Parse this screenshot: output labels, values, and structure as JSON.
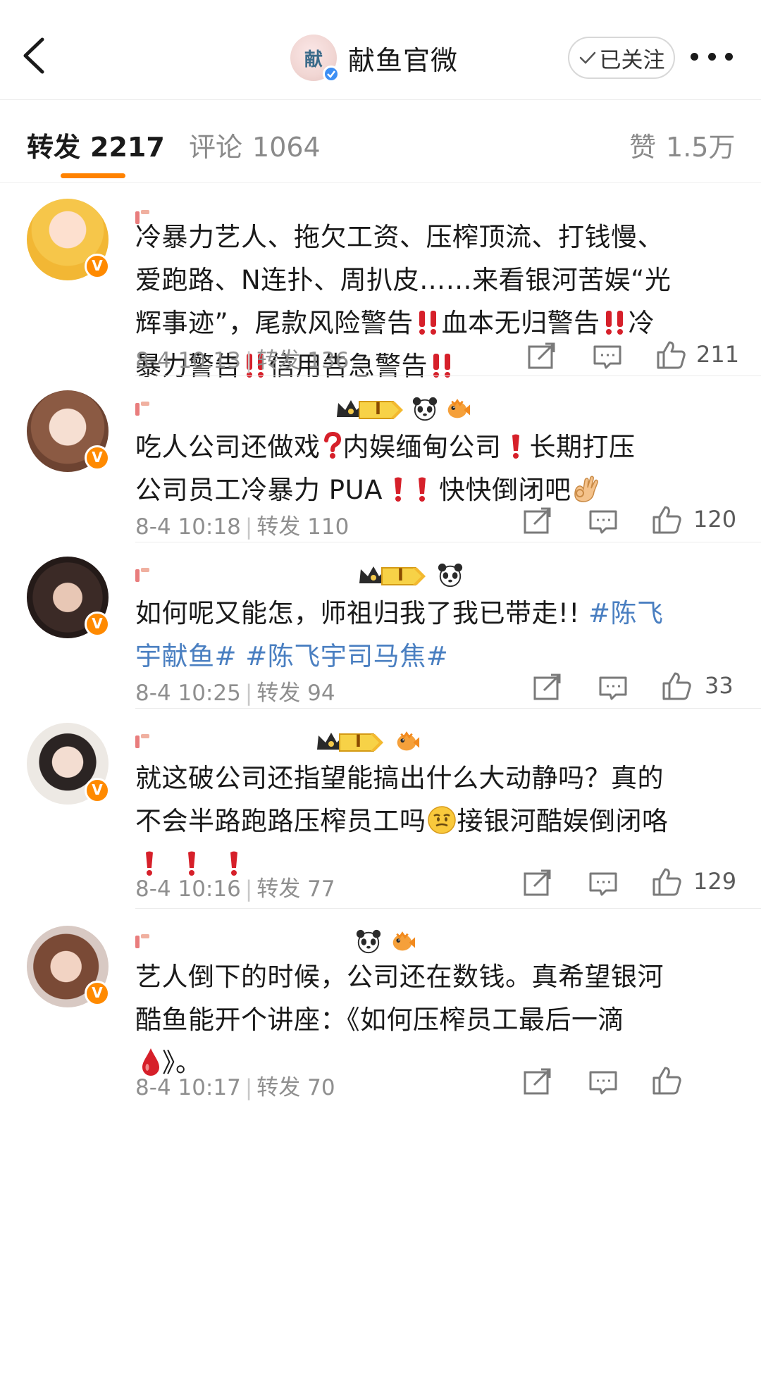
{
  "header": {
    "account_name": "献鱼官微",
    "avatar_text": "献",
    "follow_label": "已关注"
  },
  "tabs": [
    {
      "label": "转发",
      "count": "2217"
    },
    {
      "label": "评论",
      "count": "1064"
    },
    {
      "label": "赞",
      "count": "1.5万"
    }
  ],
  "comments": [
    {
      "lines": [
        "冷暴力艺人、拖欠工资、压榨顶流、打钱慢、",
        "爱跑路、N连扑、周扒皮……来看银河苦娱“光",
        "辉事迹”，尾款风险警告",
        "血本无归警告",
        "冷",
        "暴力警告",
        "信用告急警告"
      ],
      "time": "8-4 10:13",
      "repost": "转发 136",
      "likes": "211"
    },
    {
      "lines": [
        "吃人公司还做戏",
        "内娱缅甸公司",
        "长期打压",
        "公司员工冷暴力 PUA",
        "快快倒闭吧"
      ],
      "time": "8-4 10:18",
      "repost": "转发 110",
      "likes": "120"
    },
    {
      "lines": [
        "如何呢又能怎，师祖归我了我已带走!! ",
        "#陈飞",
        "宇献鱼#",
        "#陈飞宇司马焦#"
      ],
      "time": "8-4 10:25",
      "repost": "转发 94",
      "likes": "33"
    },
    {
      "lines": [
        "就这破公司还指望能搞出什么大动静吗？真的",
        "不会半路跑路压榨员工吗",
        "接银河酷娱倒闭咯"
      ],
      "time": "8-4 10:16",
      "repost": "转发 77",
      "likes": "129"
    },
    {
      "lines": [
        "艺人倒下的时候，公司还在数钱。真希望银河",
        "酷鱼能开个讲座：《如何压榨员工最后一滴",
        "》。"
      ],
      "time": "8-4 10:17",
      "repost": "转发 70",
      "likes": ""
    }
  ],
  "level_badge": "I",
  "colors": {
    "accent": "#ff8200",
    "verified": "#ff8a00",
    "link": "#4a7fc1",
    "warning": "#d6202a"
  }
}
